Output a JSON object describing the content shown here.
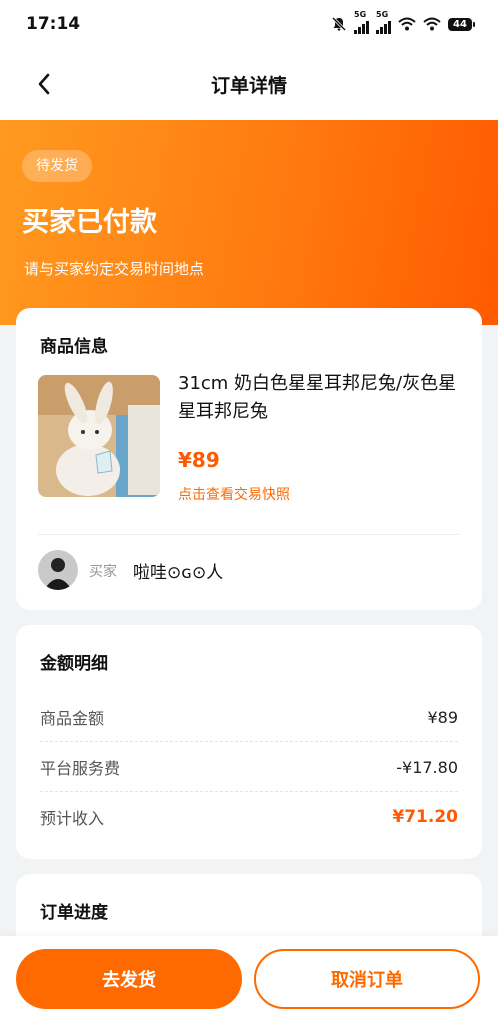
{
  "status_bar": {
    "time": "17:14",
    "net1": "5G",
    "net2": "5G",
    "battery": "44"
  },
  "nav": {
    "title": "订单详情"
  },
  "hero": {
    "badge": "待发货",
    "title": "买家已付款",
    "subtitle": "请与买家约定交易时间地点"
  },
  "product_card": {
    "title": "商品信息",
    "name": "31cm 奶白色星星耳邦尼兔/灰色星星耳邦尼兔",
    "price": "¥89",
    "snapshot_link": "点击查看交易快照",
    "buyer_label": "买家",
    "buyer_name": "啦哇⊙ɢ⊙人"
  },
  "amount_card": {
    "title": "金额明细",
    "rows": [
      {
        "label": "商品金额",
        "value": "¥89"
      },
      {
        "label": "平台服务费",
        "value": "-¥17.80"
      },
      {
        "label": "预计收入",
        "value": "¥71.20"
      }
    ]
  },
  "progress_card": {
    "title": "订单进度"
  },
  "actions": {
    "ship": "去发货",
    "cancel": "取消订单"
  },
  "colors": {
    "accent": "#ff6a00",
    "hero_start": "#ff9a1f",
    "hero_end": "#ff5a00"
  }
}
